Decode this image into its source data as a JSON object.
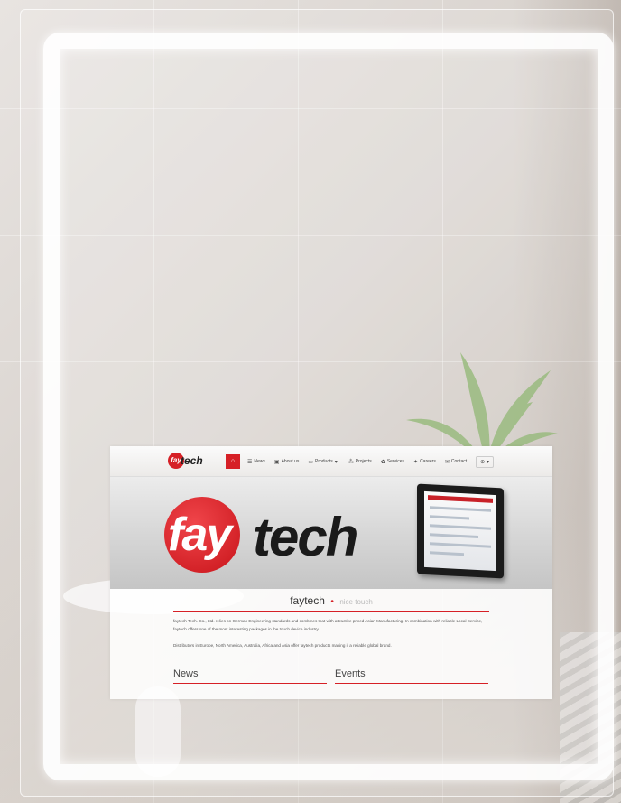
{
  "site": {
    "logo": {
      "badge": "fay",
      "text": "tech"
    },
    "nav": {
      "home_icon": "home-icon",
      "items": [
        {
          "label": "News",
          "icon": "list-icon"
        },
        {
          "label": "About us",
          "icon": "info-icon"
        },
        {
          "label": "Products",
          "icon": "monitor-icon",
          "dropdown": true
        },
        {
          "label": "Projects",
          "icon": "people-icon"
        },
        {
          "label": "Services",
          "icon": "gear-icon"
        },
        {
          "label": "Careers",
          "icon": "group-icon"
        },
        {
          "label": "Contact",
          "icon": "mail-icon"
        }
      ],
      "language": "globe-icon"
    },
    "hero": {
      "fay": "fay",
      "tech": "tech"
    },
    "headline": {
      "main": "faytech",
      "sub": "nice touch"
    },
    "paragraph1": "faytech Tech. Co., Ltd. relies on German Engineering standards and combines that with attractive priced Asian Manufacturing. In combination with reliable Local Service, faytech offers one of the most interesting packages in the touch device industry.",
    "paragraph2": "Distributors in Europe, North America, Australia, Africa and Asia offer faytech products making it a reliable global brand.",
    "sections": {
      "news": "News",
      "events": "Events"
    }
  },
  "colors": {
    "brand_red": "#d62026",
    "text_dark": "#222222"
  }
}
